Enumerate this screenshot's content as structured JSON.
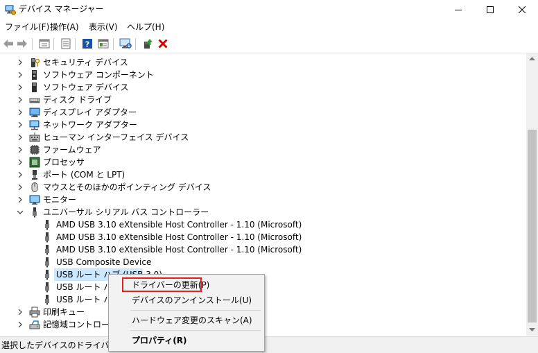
{
  "window": {
    "title": "デバイス マネージャー",
    "controls": [
      "minimize",
      "maximize",
      "close"
    ]
  },
  "menubar": {
    "items": [
      "ファイル(F)",
      "操作(A)",
      "表示(V)",
      "ヘルプ(H)"
    ]
  },
  "toolbar": {
    "buttons": [
      "back-arrow-icon",
      "forward-arrow-icon",
      "show-hidden-icon",
      "properties-icon",
      "help-icon",
      "view-icon",
      "monitor-scan-icon",
      "update-driver-icon",
      "uninstall-icon"
    ]
  },
  "tree": {
    "categories": [
      {
        "label": "セキュリティ デバイス",
        "icon": "security-device-icon",
        "expanded": false
      },
      {
        "label": "ソフトウェア コンポーネント",
        "icon": "software-component-icon",
        "expanded": false
      },
      {
        "label": "ソフトウェア デバイス",
        "icon": "software-device-icon",
        "expanded": false
      },
      {
        "label": "ディスク ドライブ",
        "icon": "disk-drive-icon",
        "expanded": false
      },
      {
        "label": "ディスプレイ アダプター",
        "icon": "display-adapter-icon",
        "expanded": false
      },
      {
        "label": "ネットワーク アダプター",
        "icon": "network-adapter-icon",
        "expanded": false
      },
      {
        "label": "ヒューマン インターフェイス デバイス",
        "icon": "hid-icon",
        "expanded": false
      },
      {
        "label": "ファームウェア",
        "icon": "firmware-icon",
        "expanded": false
      },
      {
        "label": "プロセッサ",
        "icon": "processor-icon",
        "expanded": false
      },
      {
        "label": "ポート (COM と LPT)",
        "icon": "port-icon",
        "expanded": false
      },
      {
        "label": "マウスとそのほかのポインティング デバイス",
        "icon": "mouse-icon",
        "expanded": false
      },
      {
        "label": "モニター",
        "icon": "monitor-icon",
        "expanded": false
      },
      {
        "label": "ユニバーサル シリアル バス コントローラー",
        "icon": "usb-controller-icon",
        "expanded": true
      }
    ],
    "usb_children": [
      {
        "label": "AMD USB 3.10 eXtensible Host Controller - 1.10 (Microsoft)",
        "selected": false
      },
      {
        "label": "AMD USB 3.10 eXtensible Host Controller - 1.10 (Microsoft)",
        "selected": false
      },
      {
        "label": "AMD USB 3.10 eXtensible Host Controller - 1.10 (Microsoft)",
        "selected": false
      },
      {
        "label": "USB Composite Device",
        "selected": false
      },
      {
        "label": "USB ルート ハブ (USB 3.0)",
        "selected": true
      },
      {
        "label": "USB ルート ハブ",
        "selected": false
      },
      {
        "label": "USB ルート ハブ",
        "selected": false
      }
    ],
    "after": [
      {
        "label": "印刷キュー",
        "icon": "print-queue-icon",
        "expanded": false
      },
      {
        "label": "記憶域コントローラー",
        "icon": "storage-controller-icon",
        "expanded": false
      }
    ]
  },
  "context_menu": {
    "items": [
      {
        "label": "ドライバーの更新(P)",
        "bold": false,
        "highlighted": true
      },
      {
        "label": "デバイスのアンインストール(U)",
        "bold": false,
        "highlighted": false
      },
      {
        "label": "ハードウェア変更のスキャン(A)",
        "bold": false,
        "highlighted": false
      },
      {
        "label": "プロパティ(R)",
        "bold": true,
        "highlighted": false
      }
    ],
    "highlight_color": "#e11f1f"
  },
  "statusbar": {
    "text": "選択したデバイスのドライバー更新"
  },
  "colors": {
    "selection": "#cce8ff",
    "uninstall_red": "#d40000",
    "help_blue": "#1c4fa8"
  }
}
